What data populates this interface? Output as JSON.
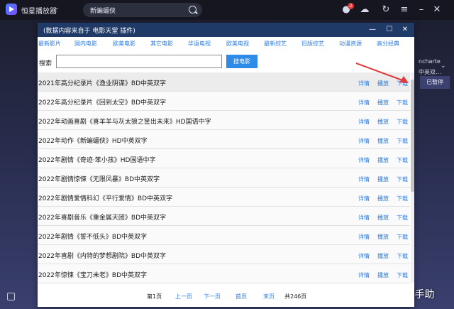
{
  "app": {
    "title": "恒星播放器",
    "search_value": "新蝙蝠侠",
    "notification_count": "2",
    "side_panel": {
      "line1": "ncharte",
      "line2": "中英双...",
      "pause_label": "已暂停"
    }
  },
  "dialog": {
    "title": "(数据内容来自于 电影天堂 插件)",
    "nav": [
      "最新影片",
      "国内电影",
      "欧美电影",
      "其它电影",
      "华语电视",
      "欧美电视",
      "最新综艺",
      "旧版综艺",
      "动漫资源",
      "高分经典"
    ],
    "search_label": "搜索",
    "search_value": "",
    "search_button": "搜电影",
    "action_labels": {
      "detail": "详情",
      "play": "播放",
      "download": "下载"
    },
    "rows": [
      "2021年高分纪录片《渔业阴谋》BD中英双字",
      "2022年高分纪录片《回到太空》BD中英双字",
      "2022年动画喜剧《喜羊羊与灰太狼之筐出未来》HD国语中字",
      "2022年动作《新蝙蝠侠》HD中英双字",
      "2022年剧情《奇迹·笨小孩》HD国语中字",
      "2022年剧情惊悚《无限风暴》BD中英双字",
      "2022年剧情爱情科幻《平行爱情》BD中英双字",
      "2022年喜剧音乐《重金属天团》BD中英双字",
      "2022年剧情《誓不低头》BD中英双字",
      "2022年喜剧《内特的梦想剧院》BD中英双字",
      "2022年惊悚《宝刀未老》BD中英双字"
    ],
    "pager": {
      "current": "第1页",
      "prev": "上一页",
      "next": "下一页",
      "first": "首页",
      "last": "末页",
      "total": "共246页"
    }
  },
  "watermark": "头条 @极速手助",
  "colors": {
    "titlebar": "#1f3a66",
    "link": "#2a7ae2",
    "button": "#2f8be8",
    "arrow": "#e03a3a"
  }
}
